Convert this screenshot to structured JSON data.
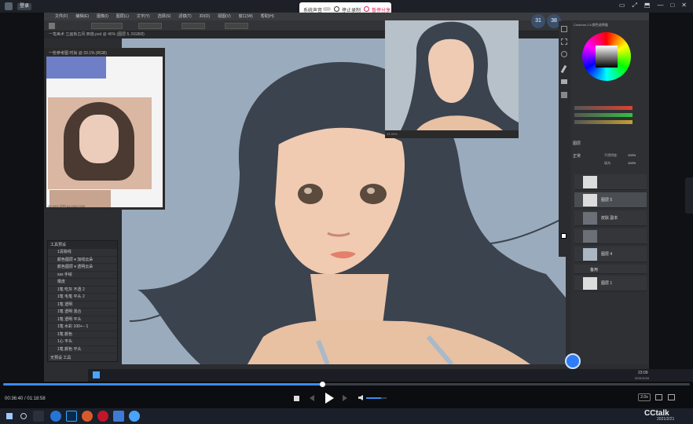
{
  "topbar": {
    "login_label": "登录"
  },
  "recorder": {
    "audio_label": "系统声音",
    "stop_label": "停止录制",
    "share_label": "暂停分享",
    "accent": "#e0245e"
  },
  "photoshop": {
    "menu": [
      "文件(F)",
      "编辑(E)",
      "图像(I)",
      "图层(L)",
      "文字(Y)",
      "选择(S)",
      "滤镜(T)",
      "3D(D)",
      "视图(V)",
      "窗口(W)",
      "帮助(H)"
    ],
    "doc_tab": "一笔美术 立画板古风 西施.psd @ 46% (图层 5, RGB/8)",
    "zoom_status": "33.33%",
    "ref_window_title": "一些参考图 时尚 @ 33.1% (RGB)",
    "ref_status": "33.33%  文档:44.1M/4.02M",
    "actions_title": "工具预设",
    "actions": [
      "1清除线",
      "颜色图层 ▾ 加线云朵",
      "颜色图层 ▾ 透明云朵",
      "sss 手绘",
      "橡皮",
      "1笔 吃灰 不透 2",
      "1笔 毛笔 平头 2",
      "1笔 透明",
      "1笔 透明 混合",
      "1笔 透明 平头",
      "1笔 水彩 100+-- 1",
      "1笔 颜色",
      "1心 平头",
      "1笔 颜色 平头"
    ],
    "actions_footer": "无预设 工具",
    "color_panel_title": "Coolorus 2.6 颜色选择器",
    "layers_tab": "图层",
    "blend_mode": "正常",
    "opacity_label": "不透明度:",
    "opacity": "100%",
    "fill_label": "填充:",
    "fill": "100%",
    "layers": [
      {
        "name": ""
      },
      {
        "name": "图层 5"
      },
      {
        "name": "皮肤 副本"
      },
      {
        "name": ""
      },
      {
        "name": "图层 4"
      },
      {
        "name": "备用"
      },
      {
        "name": "图层 1"
      }
    ],
    "badges": [
      "31",
      "38"
    ]
  },
  "inner_taskbar": {
    "clock": "23:09",
    "date": "2021/2/18"
  },
  "player": {
    "current_time": "00:36:40",
    "total_time": "01:18:58",
    "progress": 0.464,
    "volume": 0.72,
    "speed": "2.0x",
    "accent": "#3b8cf0"
  },
  "system_taskbar": {
    "app_name": "CCtalk",
    "date": "2021/2/21"
  }
}
